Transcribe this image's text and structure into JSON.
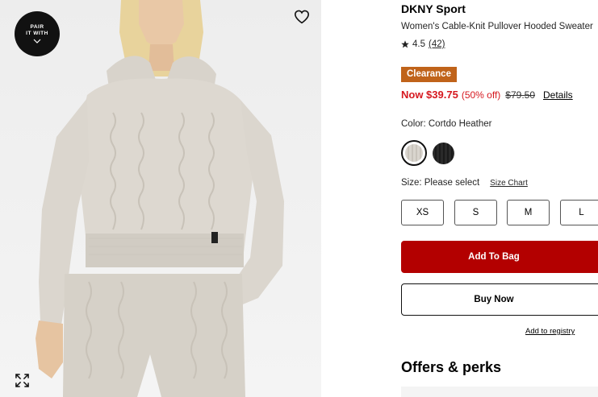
{
  "product": {
    "brand": "DKNY Sport",
    "title": "Women's Cable-Knit Pullover Hooded Sweater",
    "rating": "4.5",
    "review_count": "(42)",
    "badge": "Clearance",
    "price_now": "Now $39.75",
    "discount": "(50% off)",
    "price_original": "$79.50",
    "details_link": "Details"
  },
  "image": {
    "pair_badge_line1": "PAIR",
    "pair_badge_line2": "IT WITH",
    "icons": [
      "chevron-down-icon",
      "heart-icon",
      "expand-icon",
      "star-icon"
    ]
  },
  "color": {
    "label": "Color: Cortdo Heather",
    "swatches": [
      {
        "name": "Cortdo Heather",
        "hex": "#d3cec6",
        "selected": true
      },
      {
        "name": "Black",
        "hex": "#222222",
        "selected": false
      }
    ]
  },
  "size": {
    "label": "Size: Please select",
    "chart_link": "Size Chart",
    "options": [
      "XS",
      "S",
      "M",
      "L"
    ]
  },
  "actions": {
    "add_to_bag": "Add To Bag",
    "buy_now": "Buy Now",
    "registry": "Add to registry"
  },
  "offers": {
    "heading": "Offers & perks"
  },
  "colors": {
    "clearance": "#c0631a",
    "sale_red": "#d6181f",
    "add_bag": "#b30000"
  }
}
